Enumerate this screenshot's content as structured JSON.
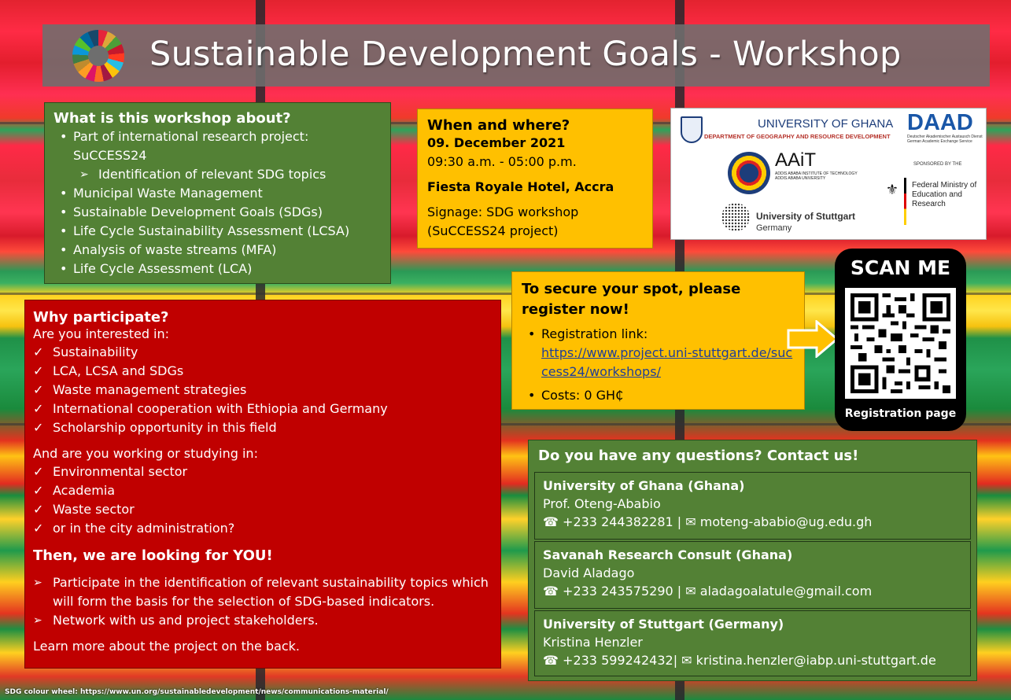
{
  "title": "Sustainable Development Goals - Workshop",
  "about": {
    "heading": "What is this workshop about?",
    "items": [
      "Part of international research project: SuCCESS24",
      "Identification of relevant SDG topics",
      "Municipal Waste Management",
      "Sustainable Development Goals (SDGs)",
      "Life Cycle Sustainability Assessment (LCSA)",
      "Analysis of waste streams (MFA)",
      "Life Cycle Assessment (LCA)"
    ]
  },
  "when": {
    "heading": "When and where?",
    "date": "09. December 2021",
    "time": "09:30 a.m. - 05:00 p.m.",
    "venue": "Fiesta Royale Hotel, Accra",
    "signage": "Signage: SDG workshop (SuCCESS24 project)"
  },
  "logos": {
    "ug_name": "UNIVERSITY OF GHANA",
    "ug_dept": "DEPARTMENT OF GEOGRAPHY AND RESOURCE DEVELOPMENT",
    "daad": "DAAD",
    "daad_sub": "Deutscher Akademischer Austausch Dienst German Academic Exchange Service",
    "aait": "AAiT",
    "aait_sub": "ADDIS ABABA INSTITUTE OF TECHNOLOGY ADDIS ABABA UNIVERSITY",
    "stuttgart": "University of Stuttgart",
    "stuttgart_sub": "Germany",
    "sponsored": "SPONSORED BY THE",
    "federal": "Federal Ministry of Education and Research"
  },
  "why": {
    "heading": "Why participate?",
    "intro": "Are you interested in:",
    "interests": [
      "Sustainability",
      "LCA, LCSA and SDGs",
      "Waste management strategies",
      "International cooperation with Ethiopia and Germany",
      "Scholarship opportunity in this field"
    ],
    "intro2": "And are you working or studying in:",
    "fields": [
      "Environmental sector",
      "Academia",
      "Waste sector",
      "or in the city administration?"
    ],
    "looking_heading": "Then, we are looking for YOU!",
    "actions": [
      "Participate in the identification of relevant sustainability topics which will form the basis for the selection of SDG-based indicators.",
      "Network with us and project stakeholders."
    ],
    "learn_more": "Learn more about the project on the back."
  },
  "register": {
    "heading": "To secure your spot, please register now!",
    "link_label": "Registration link:",
    "link": "https://www.project.uni-stuttgart.de/success24/workshops/",
    "costs": "Costs: 0 GH₵"
  },
  "scan": {
    "title": "SCAN ME",
    "subtitle": "Registration page"
  },
  "contact": {
    "heading": "Do you have any questions? Contact us!",
    "cards": [
      {
        "org": "University of Ghana (Ghana)",
        "person": "Prof. Oteng-Ababio",
        "phone": "+233 244382281",
        "sep": " | ",
        "email": "moteng-ababio@ug.edu.gh"
      },
      {
        "org": "Savanah Research Consult (Ghana)",
        "person": "David Aladago",
        "phone": "+233 243575290",
        "sep": " | ",
        "email": "aladagoalatule@gmail.com"
      },
      {
        "org": "University of Stuttgart (Germany)",
        "person": "Kristina Henzler",
        "phone": "+233 599242432",
        "sep": "| ",
        "email": "kristina.henzler@iabp.uni-stuttgart.de"
      }
    ]
  },
  "footer": "SDG colour wheel: https://www.un.org/sustainabledevelopment/news/communications-material/",
  "colors": {
    "green_box": "#538135",
    "red_box": "#c00000",
    "yellow_box": "#ffc000",
    "link": "#1f3f99"
  },
  "icons": [
    "sdg-wheel-icon",
    "phone-icon",
    "email-icon",
    "arrow-right-icon",
    "qr-code-icon"
  ]
}
